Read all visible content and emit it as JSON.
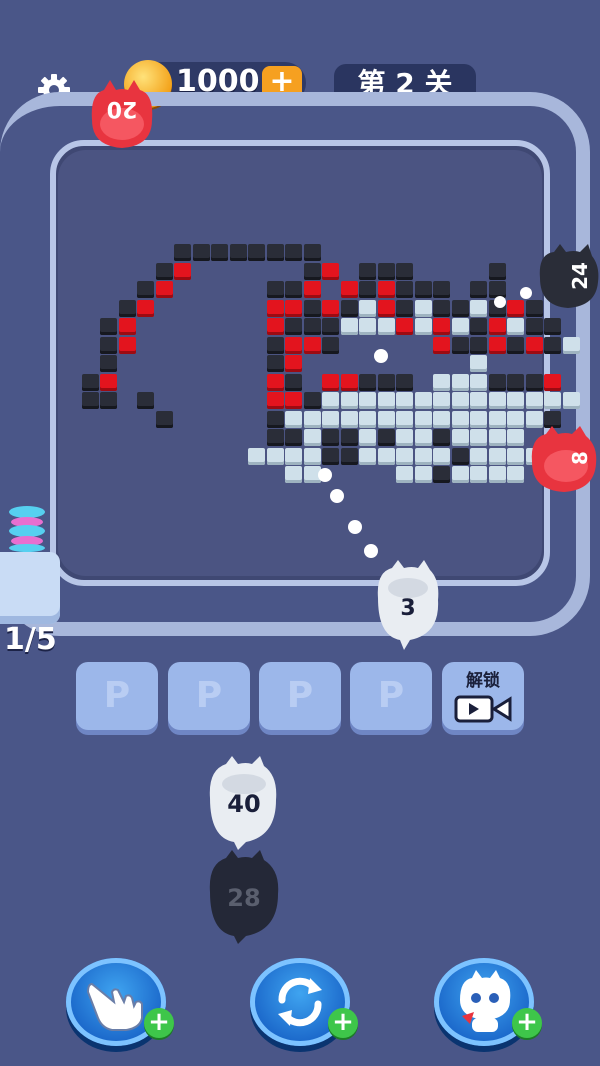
{
  "header": {
    "coins": "1000",
    "coin_plus": "+",
    "level": "第 2 关"
  },
  "game": {
    "cats_on_track": [
      {
        "id": "red-top",
        "count": "20",
        "color": "#e8343f"
      },
      {
        "id": "black-right",
        "count": "24",
        "color": "#2a2d38"
      },
      {
        "id": "red-right",
        "count": "8",
        "color": "#e8343f"
      },
      {
        "id": "white-bottom",
        "count": "3",
        "color": "#e9edf2"
      }
    ],
    "queue_counter": "1/5",
    "waiting_cats": [
      {
        "id": "white-queue",
        "count": "40",
        "color": "#e9edf2"
      },
      {
        "id": "black-queue",
        "count": "28",
        "color": "#2a2d38"
      }
    ]
  },
  "slots": {
    "labels": [
      "P",
      "P",
      "P",
      "P"
    ],
    "unlock_label": "解锁"
  },
  "boosters": [
    {
      "id": "hand",
      "icon": "hand-pointer-icon",
      "plus": "+"
    },
    {
      "id": "refresh",
      "icon": "refresh-icon",
      "plus": "+"
    },
    {
      "id": "cat",
      "icon": "cat-icon",
      "plus": "+"
    }
  ],
  "colors": {
    "background": "#4a5688",
    "track": "#a8b7db",
    "block_black": "#2a2d38",
    "block_red": "#e3141e",
    "block_white": "#cfe0ea",
    "slot": "#9cb7ea",
    "booster": "#1a66c9",
    "plus_green": "#3ec64a"
  }
}
